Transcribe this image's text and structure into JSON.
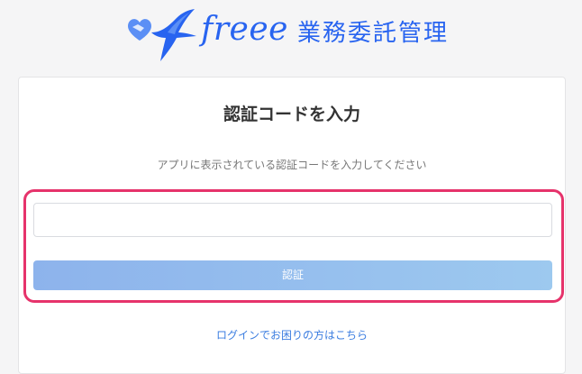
{
  "brand": {
    "wordmark": "freee",
    "product_name": "業務委託管理",
    "logo_icon": "bird-with-handshake-heart-icon",
    "color": "#2864f0"
  },
  "auth": {
    "title": "認証コードを入力",
    "description": "アプリに表示されている認証コードを入力してください",
    "code_input": {
      "value": "",
      "placeholder": ""
    },
    "submit_label": "認証",
    "help_link": "ログインでお困りの方はこちら"
  },
  "colors": {
    "highlight": "#e6336b",
    "button": "#8db3ec",
    "link": "#3b7de0"
  }
}
